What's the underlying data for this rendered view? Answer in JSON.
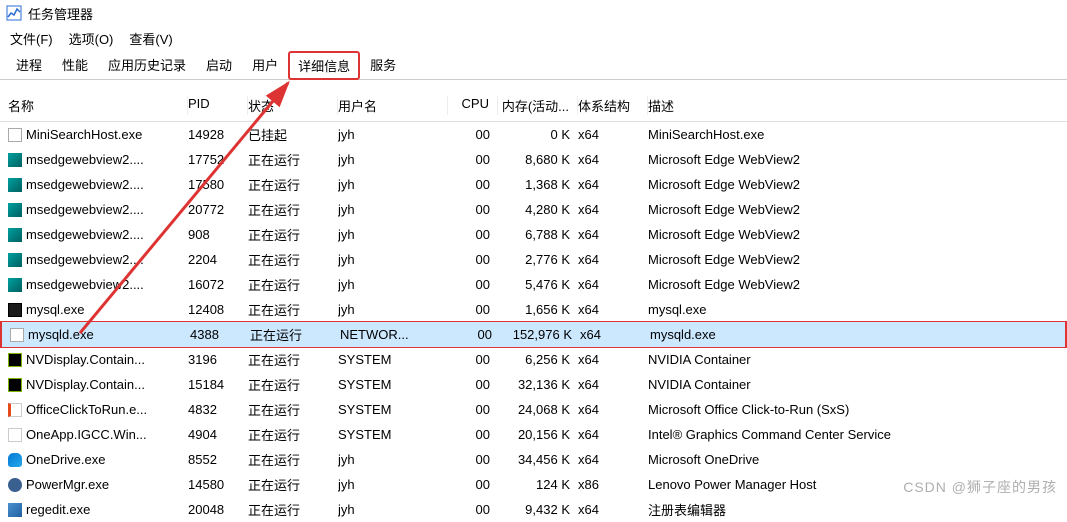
{
  "window": {
    "title": "任务管理器"
  },
  "menu": {
    "file": "文件(F)",
    "options": "选项(O)",
    "view": "查看(V)"
  },
  "tabs": [
    "进程",
    "性能",
    "应用历史记录",
    "启动",
    "用户",
    "详细信息",
    "服务"
  ],
  "activeTabIndex": 5,
  "columns": {
    "name": "名称",
    "pid": "PID",
    "status": "状态",
    "user": "用户名",
    "cpu": "CPU",
    "memory": "内存(活动...",
    "arch": "体系结构",
    "desc": "描述"
  },
  "selectedIndex": 8,
  "rows": [
    {
      "icon": "white",
      "name": "MiniSearchHost.exe",
      "pid": "14928",
      "status": "已挂起",
      "user": "jyh",
      "cpu": "00",
      "mem": "0 K",
      "arch": "x64",
      "desc": "MiniSearchHost.exe"
    },
    {
      "icon": "teal",
      "name": "msedgewebview2....",
      "pid": "17752",
      "status": "正在运行",
      "user": "jyh",
      "cpu": "00",
      "mem": "8,680 K",
      "arch": "x64",
      "desc": "Microsoft Edge WebView2"
    },
    {
      "icon": "teal",
      "name": "msedgewebview2....",
      "pid": "17580",
      "status": "正在运行",
      "user": "jyh",
      "cpu": "00",
      "mem": "1,368 K",
      "arch": "x64",
      "desc": "Microsoft Edge WebView2"
    },
    {
      "icon": "teal",
      "name": "msedgewebview2....",
      "pid": "20772",
      "status": "正在运行",
      "user": "jyh",
      "cpu": "00",
      "mem": "4,280 K",
      "arch": "x64",
      "desc": "Microsoft Edge WebView2"
    },
    {
      "icon": "teal",
      "name": "msedgewebview2....",
      "pid": "908",
      "status": "正在运行",
      "user": "jyh",
      "cpu": "00",
      "mem": "6,788 K",
      "arch": "x64",
      "desc": "Microsoft Edge WebView2"
    },
    {
      "icon": "teal",
      "name": "msedgewebview2....",
      "pid": "2204",
      "status": "正在运行",
      "user": "jyh",
      "cpu": "00",
      "mem": "2,776 K",
      "arch": "x64",
      "desc": "Microsoft Edge WebView2"
    },
    {
      "icon": "teal",
      "name": "msedgewebview2....",
      "pid": "16072",
      "status": "正在运行",
      "user": "jyh",
      "cpu": "00",
      "mem": "5,476 K",
      "arch": "x64",
      "desc": "Microsoft Edge WebView2"
    },
    {
      "icon": "dark",
      "name": "mysql.exe",
      "pid": "12408",
      "status": "正在运行",
      "user": "jyh",
      "cpu": "00",
      "mem": "1,656 K",
      "arch": "x64",
      "desc": "mysql.exe"
    },
    {
      "icon": "white",
      "name": "mysqld.exe",
      "pid": "4388",
      "status": "正在运行",
      "user": "NETWOR...",
      "cpu": "00",
      "mem": "152,976 K",
      "arch": "x64",
      "desc": "mysqld.exe"
    },
    {
      "icon": "nvidia",
      "name": "NVDisplay.Contain...",
      "pid": "3196",
      "status": "正在运行",
      "user": "SYSTEM",
      "cpu": "00",
      "mem": "6,256 K",
      "arch": "x64",
      "desc": "NVIDIA Container"
    },
    {
      "icon": "nvidia",
      "name": "NVDisplay.Contain...",
      "pid": "15184",
      "status": "正在运行",
      "user": "SYSTEM",
      "cpu": "00",
      "mem": "32,136 K",
      "arch": "x64",
      "desc": "NVIDIA Container"
    },
    {
      "icon": "office",
      "name": "OfficeClickToRun.e...",
      "pid": "4832",
      "status": "正在运行",
      "user": "SYSTEM",
      "cpu": "00",
      "mem": "24,068 K",
      "arch": "x64",
      "desc": "Microsoft Office Click-to-Run (SxS)"
    },
    {
      "icon": "intel",
      "name": "OneApp.IGCC.Win...",
      "pid": "4904",
      "status": "正在运行",
      "user": "SYSTEM",
      "cpu": "00",
      "mem": "20,156 K",
      "arch": "x64",
      "desc": "Intel® Graphics Command Center Service"
    },
    {
      "icon": "onedrive",
      "name": "OneDrive.exe",
      "pid": "8552",
      "status": "正在运行",
      "user": "jyh",
      "cpu": "00",
      "mem": "34,456 K",
      "arch": "x64",
      "desc": "Microsoft OneDrive"
    },
    {
      "icon": "gear",
      "name": "PowerMgr.exe",
      "pid": "14580",
      "status": "正在运行",
      "user": "jyh",
      "cpu": "00",
      "mem": "124 K",
      "arch": "x86",
      "desc": "Lenovo Power Manager Host"
    },
    {
      "icon": "reg",
      "name": "regedit.exe",
      "pid": "20048",
      "status": "正在运行",
      "user": "jyh",
      "cpu": "00",
      "mem": "9,432 K",
      "arch": "x64",
      "desc": "注册表编辑器"
    }
  ],
  "watermark": "CSDN @狮子座的男孩"
}
